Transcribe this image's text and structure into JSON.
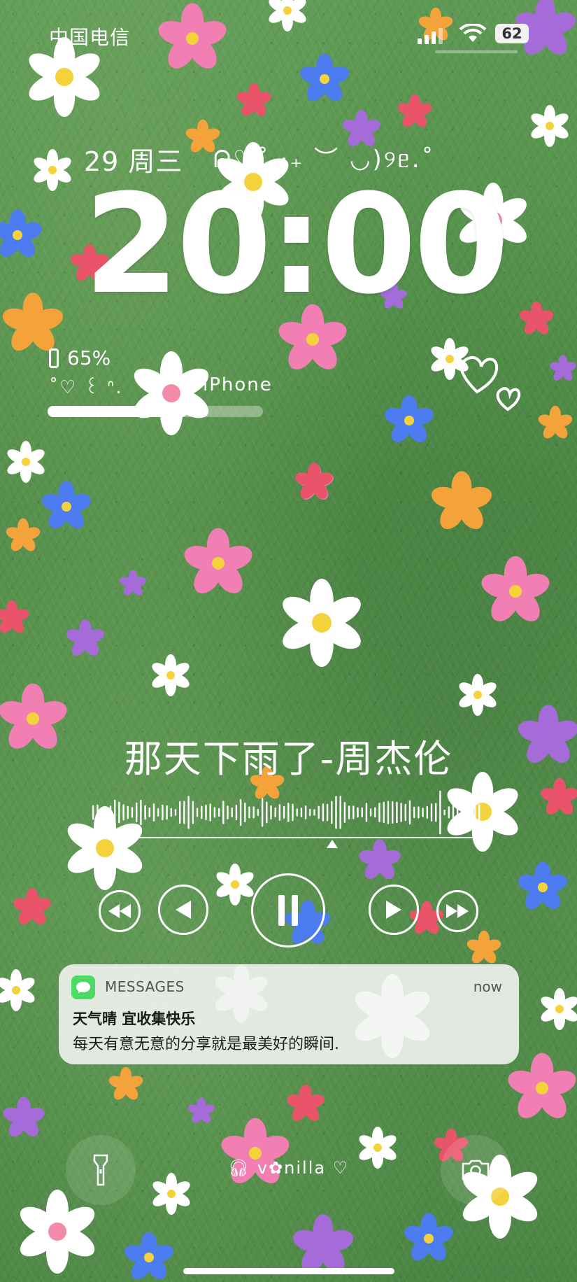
{
  "status_bar": {
    "carrier": "中国电信",
    "battery_level": "62",
    "signal_icon": "cellular-signal-icon",
    "wifi_icon": "wifi-icon"
  },
  "lock": {
    "date": "29 周三",
    "kaomoji": "ᕱ♡˚ ·₊ ︶ ◡)୨ᥱ.˚",
    "time": "20:00"
  },
  "battery_widget": {
    "percent_label": "65%",
    "percent_value": 0.65,
    "decoration": "˚♡ ꒰ ᐢ.",
    "device_name": "iPhone"
  },
  "music": {
    "song_title": "那天下雨了-周杰伦",
    "controls": {
      "rewind": "rewind-icon",
      "previous": "previous-icon",
      "play_pause": "pause-icon",
      "next": "next-icon",
      "fast_forward": "fast-forward-icon"
    }
  },
  "notification": {
    "app_name": "MESSAGES",
    "time": "now",
    "title": "天气晴 宜收集快乐",
    "body": "每天有意无意的分享就是最美好的瞬间."
  },
  "footer": {
    "text": "v✿nilla",
    "left_button": "flashlight-icon",
    "right_button": "camera-icon"
  },
  "colors": {
    "background": "#5a9450",
    "notification_bg": "#f8f8f8",
    "messages_green": "#4cd964"
  }
}
